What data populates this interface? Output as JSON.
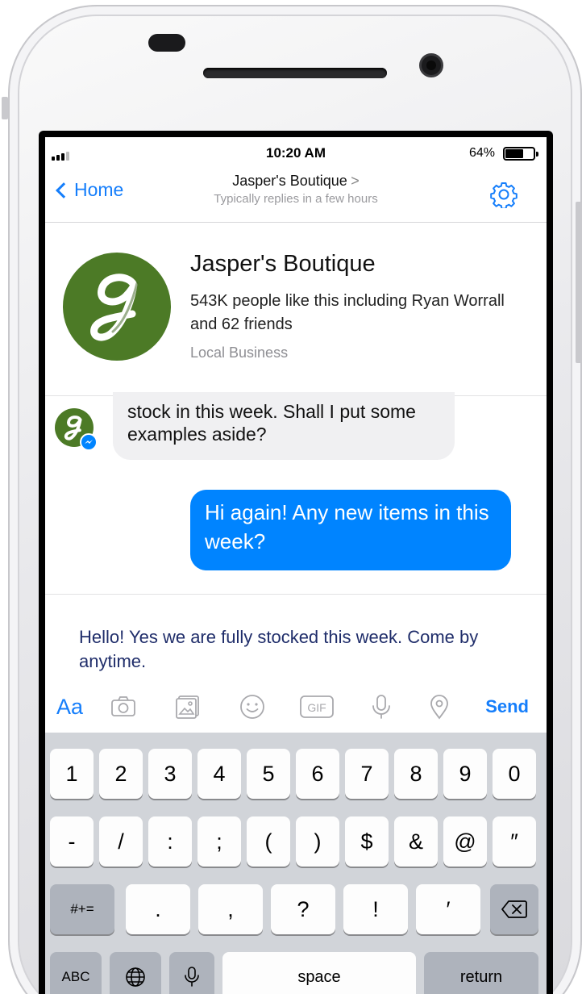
{
  "status_bar": {
    "time": "10:20 AM",
    "battery": "64%"
  },
  "nav": {
    "back_label": "Home",
    "title": "Jasper's Boutique",
    "title_chevron": ">",
    "subtitle": "Typically replies in a few hours",
    "settings_icon": "gear-icon"
  },
  "page": {
    "avatar_letter": "g",
    "name": "Jasper's Boutique",
    "likes": "543K people like this including Ryan Worrall and 62 friends",
    "category": "Local Business"
  },
  "messages": [
    {
      "from": "page",
      "text": "stock in this week. Shall I put some examples aside?"
    },
    {
      "from": "me",
      "text": "Hi again! Any new items in this week?"
    }
  ],
  "composer": {
    "text": "Hello! Yes we are fully stocked this week. Come by anytime.",
    "aa_label": "Aa",
    "gif_label": "GIF",
    "send_label": "Send",
    "accent_color": "#157efb"
  },
  "keyboard": {
    "row1": [
      "1",
      "2",
      "3",
      "4",
      "5",
      "6",
      "7",
      "8",
      "9",
      "0"
    ],
    "row2": [
      "-",
      "/",
      ":",
      ";",
      "(",
      ")",
      "$",
      "&",
      "@",
      "″"
    ],
    "row3": [
      "#+=",
      ".",
      ",",
      "?",
      "!",
      "′"
    ],
    "row4": [
      "ABC",
      "space",
      "return"
    ]
  },
  "colors": {
    "messenger_blue": "#0084ff",
    "brand_green": "#4c7a26",
    "incoming_bubble": "#f0f0f2"
  }
}
